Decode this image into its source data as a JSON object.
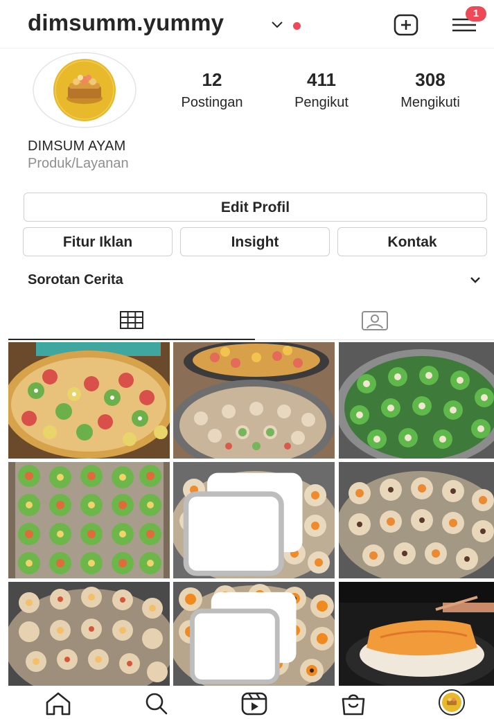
{
  "header": {
    "username": "dimsumm.yummy",
    "notification_count": "1"
  },
  "profile": {
    "stats": [
      {
        "value": "12",
        "label": "Postingan"
      },
      {
        "value": "411",
        "label": "Pengikut"
      },
      {
        "value": "308",
        "label": "Mengikuti"
      }
    ],
    "display_name": "DIMSUM AYAM",
    "category": "Produk/Layanan"
  },
  "actions": {
    "edit_profile": "Edit Profil",
    "ads_tools": "Fitur Iklan",
    "insights": "Insight",
    "contact": "Kontak"
  },
  "highlights": {
    "title": "Sorotan Cerita"
  },
  "tabs": [
    {
      "icon": "grid-icon",
      "active": true
    },
    {
      "icon": "tagged-person-icon",
      "active": false
    }
  ],
  "posts": [
    {
      "icon": "photo",
      "multiple": false
    },
    {
      "icon": "photo",
      "multiple": false
    },
    {
      "icon": "photo",
      "multiple": false
    },
    {
      "icon": "photo",
      "multiple": false
    },
    {
      "icon": "photo",
      "multiple": true
    },
    {
      "icon": "photo",
      "multiple": false
    },
    {
      "icon": "photo",
      "multiple": false
    },
    {
      "icon": "photo",
      "multiple": true
    },
    {
      "icon": "photo",
      "multiple": false
    }
  ],
  "bottom_nav": [
    "home-icon",
    "search-icon",
    "reels-icon",
    "shop-icon",
    "profile-avatar"
  ],
  "colors": {
    "badge": "#ed4956",
    "avatar_yellow": "#e8b92a",
    "text": "#262626",
    "muted": "#8e8e8e"
  }
}
